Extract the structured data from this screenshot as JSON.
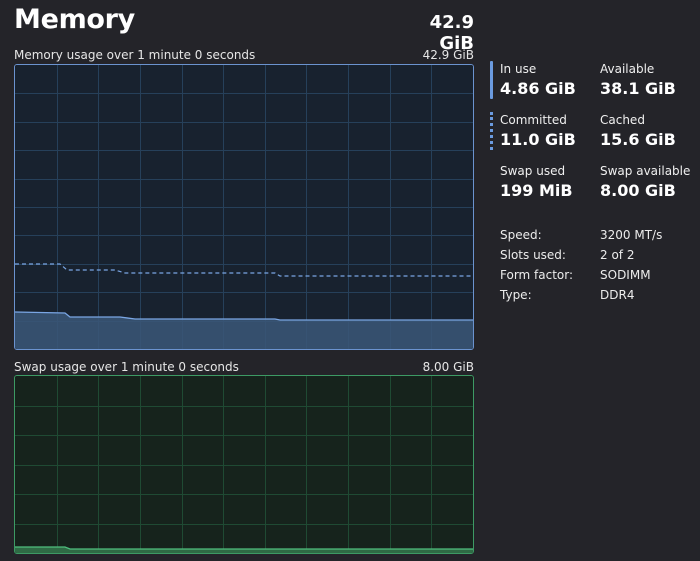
{
  "header": {
    "title": "Memory",
    "total": "42.9 GiB"
  },
  "memory_graph": {
    "caption": "Memory usage over 1 minute 0 seconds",
    "max_label": "42.9 GiB"
  },
  "swap_graph": {
    "caption": "Swap usage over 1 minute 0 seconds",
    "max_label": "8.00 GiB"
  },
  "stats": {
    "in_use": {
      "label": "In use",
      "value": "4.86 GiB"
    },
    "available": {
      "label": "Available",
      "value": "38.1 GiB"
    },
    "committed": {
      "label": "Committed",
      "value": "11.0 GiB"
    },
    "cached": {
      "label": "Cached",
      "value": "15.6 GiB"
    },
    "swap_used": {
      "label": "Swap used",
      "value": "199 MiB"
    },
    "swap_available": {
      "label": "Swap available",
      "value": "8.00 GiB"
    }
  },
  "specs": {
    "speed": {
      "label": "Speed:",
      "value": "3200 MT/s"
    },
    "slots": {
      "label": "Slots used:",
      "value": "2 of 2"
    },
    "form_factor": {
      "label": "Form factor:",
      "value": "SODIMM"
    },
    "type": {
      "label": "Type:",
      "value": "DDR4"
    }
  },
  "colors": {
    "background": "#242429",
    "memory_accent": "#6b93cf",
    "memory_fill": "#3b5778",
    "swap_accent": "#3d9a64",
    "swap_fill": "#2f6b45",
    "grid_memory": "#26405a",
    "grid_swap": "#1f4a33"
  }
}
